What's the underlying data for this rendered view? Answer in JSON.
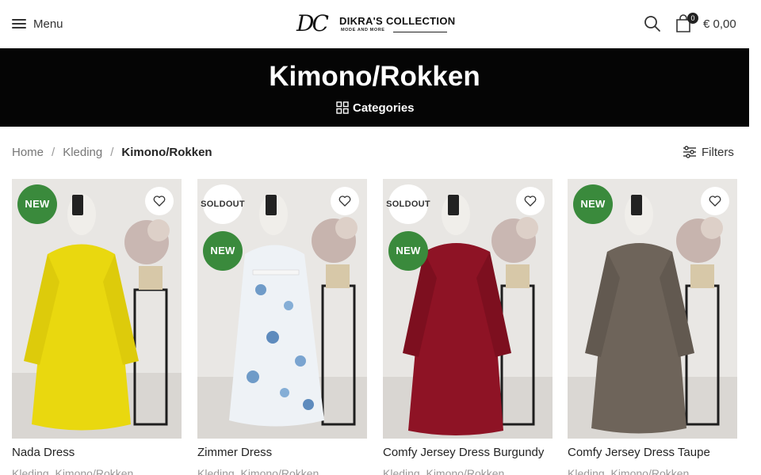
{
  "header": {
    "menu_label": "Menu",
    "logo_monogram": "DC",
    "logo_name": "DIKRA'S COLLECTION",
    "logo_tagline": "MODE AND MORE",
    "cart_count": "0",
    "cart_total": "€ 0,00",
    "icons": [
      "hamburger-icon",
      "search-icon",
      "shopping-bag-icon"
    ]
  },
  "title_bar": {
    "title": "Kimono/Rokken",
    "categories_label": "Categories",
    "background": "#050505"
  },
  "breadcrumb": {
    "home": "Home",
    "parent": "Kleding",
    "separator": "/",
    "current": "Kimono/Rokken"
  },
  "filters_label": "Filters",
  "colors": {
    "badge_new": "#3a8a3c",
    "text": "#242424",
    "muted": "#999999"
  },
  "products": [
    {
      "name": "Nada Dress",
      "cat1": "Kleding",
      "cat2": "Kimono/Rokken",
      "cat_sep": ",",
      "badges": [
        "NEW"
      ],
      "dress_color": "#e9d80f"
    },
    {
      "name": "Zimmer Dress",
      "cat1": "Kleding",
      "cat2": "Kimono/Rokken",
      "cat_sep": ",",
      "badges": [
        "SOLD OUT",
        "NEW"
      ],
      "dress_color": "#eef2f6"
    },
    {
      "name": "Comfy Jersey Dress Burgundy",
      "cat1": "Kleding",
      "cat2": "Kimono/Rokken",
      "cat_sep": ",",
      "badges": [
        "SOLD OUT",
        "NEW"
      ],
      "dress_color": "#8e1325"
    },
    {
      "name": "Comfy Jersey Dress Taupe",
      "cat1": "Kleding",
      "cat2": "Kimono/Rokken",
      "cat_sep": ",",
      "badges": [
        "NEW"
      ],
      "dress_color": "#6e645a"
    }
  ],
  "badge_labels": {
    "new": "NEW",
    "sold_line1": "SOLD",
    "sold_line2": "OUT"
  }
}
